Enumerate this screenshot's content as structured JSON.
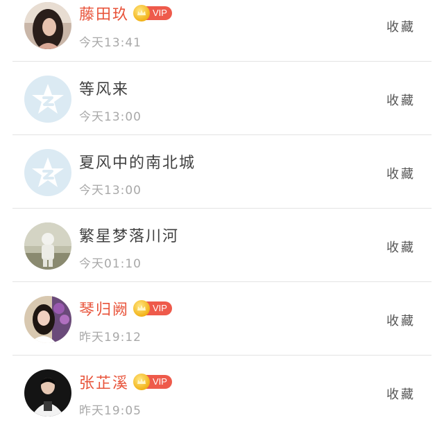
{
  "items": [
    {
      "name": "藤田玖",
      "vip": true,
      "vip_label": "VIP",
      "time": "今天13:41",
      "action": "收藏",
      "avatar": "photo-woman-dark-hair"
    },
    {
      "name": "等风来",
      "vip": false,
      "vip_label": "",
      "time": "今天13:00",
      "action": "收藏",
      "avatar": "default-qzone-star"
    },
    {
      "name": "夏风中的南北城",
      "vip": false,
      "vip_label": "",
      "time": "今天13:00",
      "action": "收藏",
      "avatar": "default-qzone-star"
    },
    {
      "name": "繁星梦落川河",
      "vip": false,
      "vip_label": "",
      "time": "今天01:10",
      "action": "收藏",
      "avatar": "photo-astronaut"
    },
    {
      "name": "琴归阙",
      "vip": true,
      "vip_label": "VIP",
      "time": "昨天19:12",
      "action": "收藏",
      "avatar": "photo-girl-flowers"
    },
    {
      "name": "张芷溪",
      "vip": true,
      "vip_label": "VIP",
      "time": "昨天19:05",
      "action": "收藏",
      "avatar": "photo-girl-tshirt"
    }
  ],
  "colors": {
    "vip_name": "#e8533a",
    "vip_badge": "#ee5a4b",
    "crown": "#f2b31a",
    "default_avatar_bg": "#dbeaf3",
    "text": "#404040",
    "time": "#a8a8a8",
    "divider": "#e3e3e3"
  }
}
